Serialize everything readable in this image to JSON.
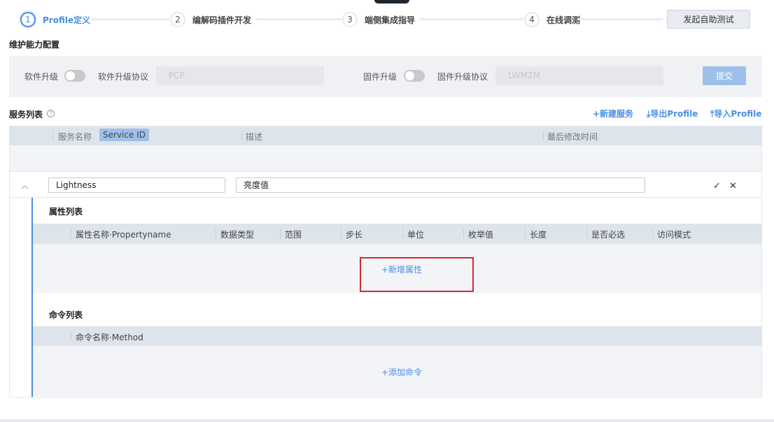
{
  "stepper": {
    "steps": [
      {
        "num": "1",
        "label": "Profile定义"
      },
      {
        "num": "2",
        "label": "编解码插件开发"
      },
      {
        "num": "3",
        "label": "端侧集成指导"
      },
      {
        "num": "4",
        "label": "在线调测"
      }
    ],
    "self_test_button": "发起自助测试"
  },
  "maintenance": {
    "title": "维护能力配置",
    "software_upgrade": "软件升级",
    "software_protocol_label": "软件升级协议",
    "software_protocol_value": "PCP",
    "firmware_upgrade": "固件升级",
    "firmware_protocol_label": "固件升级协议",
    "firmware_protocol_value": "LWM2M",
    "submit": "提交",
    "software_enabled": false,
    "firmware_enabled": false
  },
  "services": {
    "title": "服务列表",
    "new_service": "+新建服务",
    "export": "导出Profile",
    "import": "导入Profile",
    "columns": {
      "name": "服务名称",
      "service_id_tag": "Service ID",
      "desc": "描述",
      "modified": "最后修改时间"
    },
    "row": {
      "name": "Lightness",
      "desc": "亮度值"
    }
  },
  "properties": {
    "title": "属性列表",
    "columns": [
      "属性名称·Propertyname",
      "数据类型",
      "范围",
      "步长",
      "单位",
      "枚举值",
      "长度",
      "是否必选",
      "访问模式"
    ],
    "add": "+新增属性"
  },
  "commands": {
    "title": "命令列表",
    "columns": [
      "命令名称·Method"
    ],
    "add": "+添加命令"
  },
  "colors": {
    "accent": "#4a8de6",
    "highlight_box": "#e0242b"
  }
}
